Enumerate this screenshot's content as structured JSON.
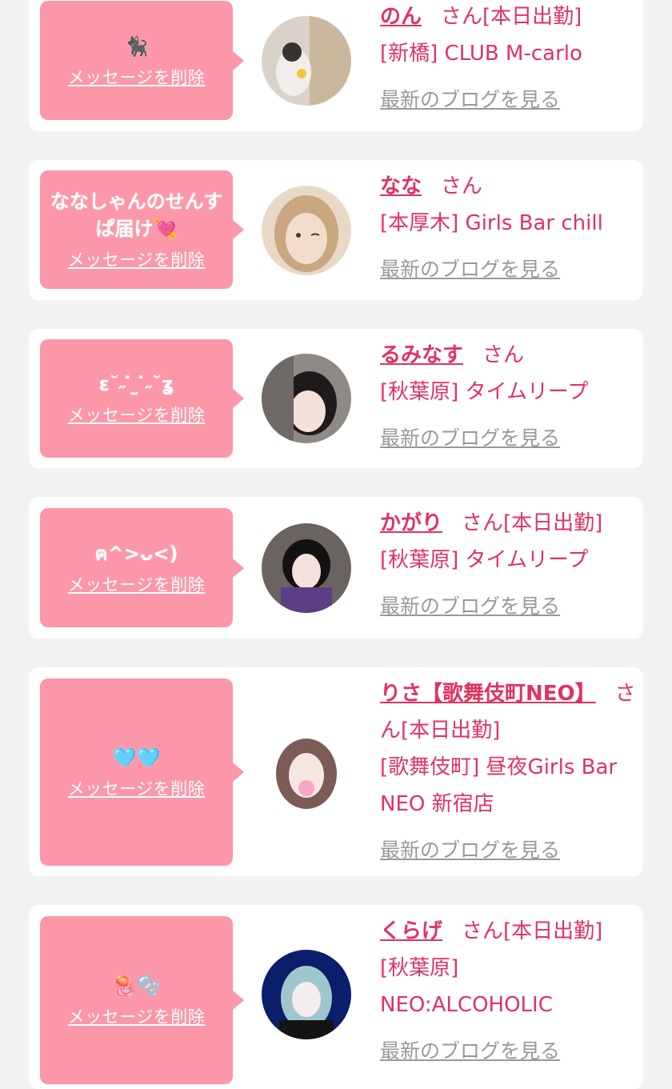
{
  "delete_label": "メッセージを削除",
  "blog_label": "最新のブログを見る",
  "san_label": "さん",
  "colors": {
    "bubble": "#fb97a9",
    "accent": "#e0335f",
    "link_gray": "#999999",
    "background": "#f2f2f2"
  },
  "entries": [
    {
      "message": "🐈‍⬛",
      "name": "のん",
      "suffix": "さん[本日出勤]",
      "location": "[新橋] CLUB M-carlo"
    },
    {
      "message": "ななしゃんのせんすぱ届け💘",
      "name": "なな",
      "suffix": "さん",
      "location": "[本厚木] Girls Bar chill"
    },
    {
      "message": "ɛ˘˶ ̇ ̫ ̇˶˘ʓ",
      "name": "るみなす",
      "suffix": "さん",
      "location": "[秋葉原] タイムリープ"
    },
    {
      "message": "ฅ^>ᴗ<)",
      "name": "かがり",
      "suffix": "さん[本日出勤]",
      "location": "[秋葉原] タイムリープ"
    },
    {
      "message": "🩵🩵",
      "name": "りさ【歌舞伎町NEO】",
      "suffix": "さん[本日出勤]",
      "location": "[歌舞伎町] 昼夜Girls Bar NEO 新宿店"
    },
    {
      "message": "🪼🫧",
      "name": "くらげ",
      "suffix": "さん[本日出勤]",
      "location": "[秋葉原] NEO:ALCOHOLIC"
    }
  ]
}
